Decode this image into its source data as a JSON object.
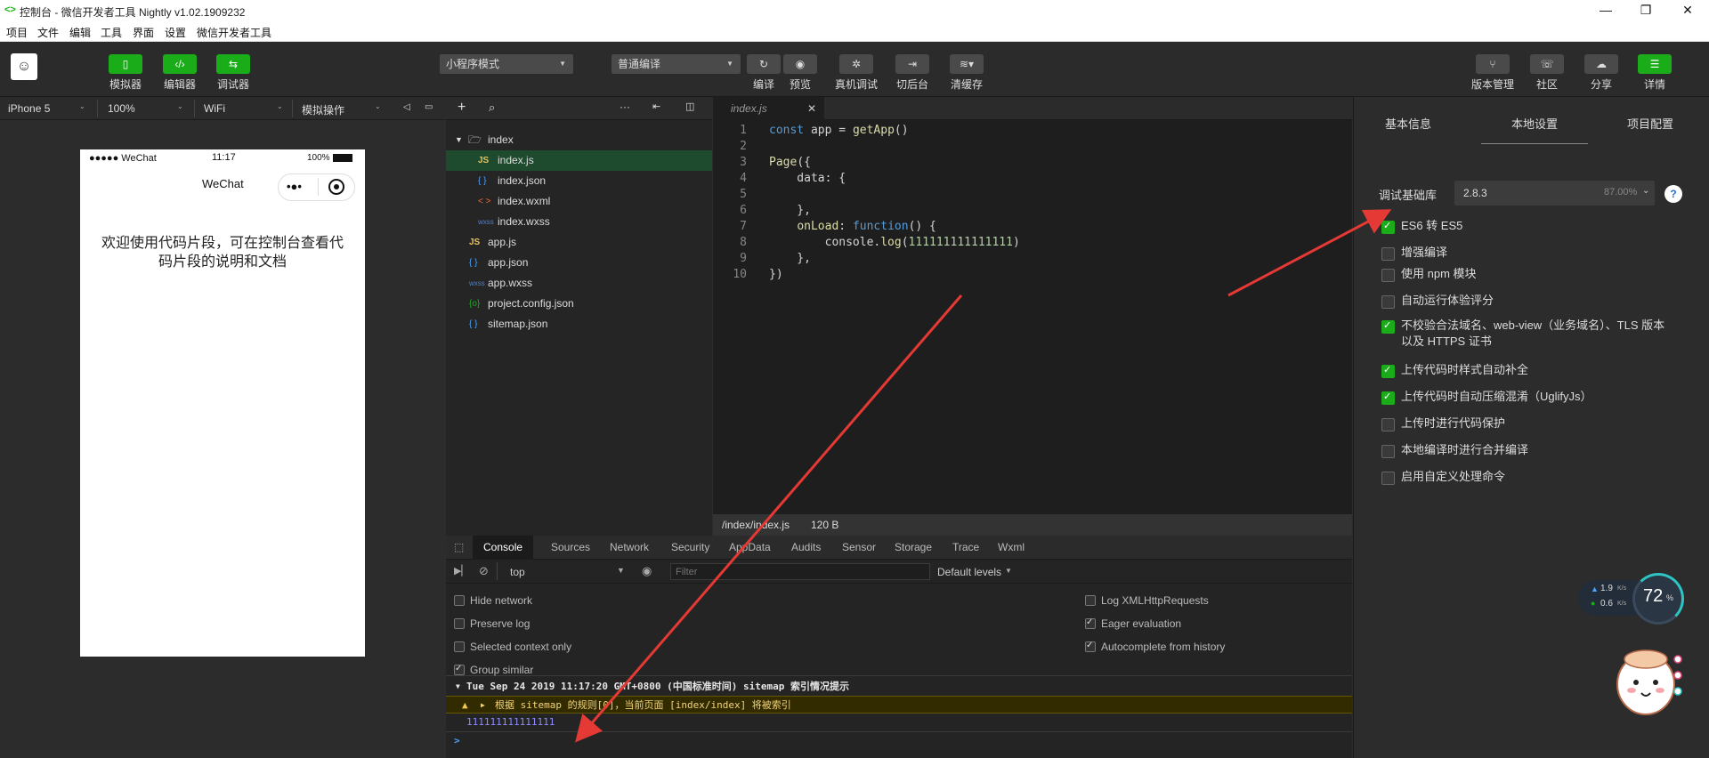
{
  "titlebar": {
    "logo": "<>",
    "title": "控制台 - 微信开发者工具 Nightly v1.02.1909232",
    "min": "—",
    "max": "❐",
    "close": "✕"
  },
  "menu": [
    "项目",
    "文件",
    "编辑",
    "工具",
    "界面",
    "设置",
    "微信开发者工具"
  ],
  "toolbar": {
    "simulator": "模拟器",
    "editor": "编辑器",
    "debugger": "调试器",
    "mode_select": "小程序模式",
    "compile_select": "普通编译",
    "compile": "编译",
    "preview": "预览",
    "remote_debug": "真机调试",
    "background": "切后台",
    "clear_cache": "清缓存",
    "version": "版本管理",
    "community": "社区",
    "share": "分享",
    "details": "详情"
  },
  "devicebar": {
    "device": "iPhone 5",
    "zoom": "100%",
    "network": "WiFi",
    "sim_ops": "模拟操作"
  },
  "phone": {
    "signal": "●●●●● WeChat",
    "time": "11:17",
    "battery": "100%",
    "nav_title": "WeChat",
    "content": "欢迎使用代码片段，可在控制台查看代码片段的说明和文档"
  },
  "tree": {
    "folder": "index",
    "items": [
      {
        "icon": "JS",
        "name": "index.js"
      },
      {
        "icon": "{ }",
        "name": "index.json"
      },
      {
        "icon": "< >",
        "name": "index.wxml"
      },
      {
        "icon": "wxss",
        "name": "index.wxss"
      },
      {
        "icon": "JS",
        "name": "app.js"
      },
      {
        "icon": "{ }",
        "name": "app.json"
      },
      {
        "icon": "wxss",
        "name": "app.wxss"
      },
      {
        "icon": "{o}",
        "name": "project.config.json"
      },
      {
        "icon": "{ }",
        "name": "sitemap.json"
      }
    ]
  },
  "editor": {
    "tab": "index.js",
    "lines": [
      "1",
      "2",
      "3",
      "4",
      "5",
      "6",
      "7",
      "8",
      "9",
      "10"
    ],
    "path": "/index/index.js",
    "size": "120 B"
  },
  "console": {
    "tabs": [
      "Console",
      "Sources",
      "Network",
      "Security",
      "AppData",
      "Audits",
      "Sensor",
      "Storage",
      "Trace",
      "Wxml"
    ],
    "context": "top",
    "filter_placeholder": "Filter",
    "levels": "Default levels",
    "left_opts": [
      "Hide network",
      "Preserve log",
      "Selected context only",
      "Group similar"
    ],
    "right_opts": [
      "Log XMLHttpRequests",
      "Eager evaluation",
      "Autocomplete from history"
    ],
    "group_header": "Tue Sep 24 2019 11:17:20 GMT+0800 (中国标准时间) sitemap 索引情况提示",
    "warning": "根据 sitemap 的规则[0]，当前页面 [index/index] 将被索引",
    "log_value": "111111111111111",
    "prompt": ">"
  },
  "rpanel": {
    "tabs": [
      "基本信息",
      "本地设置",
      "项目配置"
    ],
    "lib_label": "调试基础库",
    "lib_version": "2.8.3",
    "lib_percent": "87.00%",
    "help": "?",
    "options": [
      {
        "label": "ES6 转 ES5",
        "on": true
      },
      {
        "label": "增强编译",
        "on": false
      },
      {
        "label": "使用 npm 模块",
        "on": false
      },
      {
        "label": "自动运行体验评分",
        "on": false
      },
      {
        "label": "不校验合法域名、web-view（业务域名）、TLS 版本以及 HTTPS 证书",
        "on": true
      },
      {
        "label": "上传代码时样式自动补全",
        "on": true
      },
      {
        "label": "上传代码时自动压缩混淆（UglifyJs）",
        "on": true
      },
      {
        "label": "上传时进行代码保护",
        "on": false
      },
      {
        "label": "本地编译时进行合并编译",
        "on": false
      },
      {
        "label": "启用自定义处理命令",
        "on": false
      }
    ]
  },
  "widget": {
    "up_speed": "1.9",
    "down_speed": "0.6",
    "speed_unit": "K/s",
    "percent": "72",
    "percent_unit": "%"
  },
  "colors": {
    "accent": "#1aad19",
    "warning_bg": "#332b00",
    "arrow": "#e53935"
  }
}
